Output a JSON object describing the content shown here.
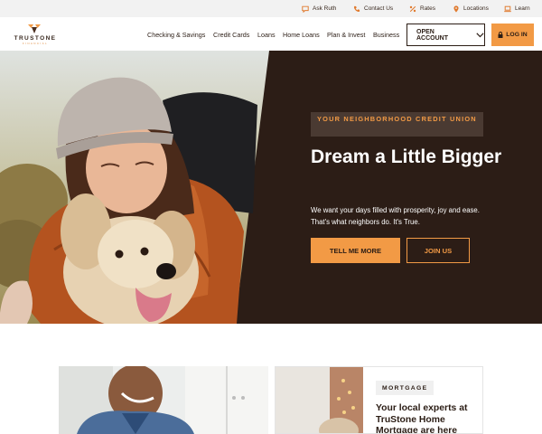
{
  "utility": {
    "items": [
      {
        "label": "Ask Ruth",
        "icon": "chat-icon"
      },
      {
        "label": "Contact Us",
        "icon": "phone-icon"
      },
      {
        "label": "Rates",
        "icon": "percent-icon"
      },
      {
        "label": "Locations",
        "icon": "location-pin-icon"
      },
      {
        "label": "Learn",
        "icon": "laptop-icon"
      }
    ]
  },
  "brand": {
    "name": "TRUSTONE",
    "tagline": "FINANCIAL",
    "accent": "#f29a45",
    "dark": "#2c1d16"
  },
  "nav": {
    "links": [
      "Checking & Savings",
      "Credit Cards",
      "Loans",
      "Home Loans",
      "Plan & Invest",
      "Business"
    ],
    "open_account": "OPEN ACCOUNT",
    "login": "LOG IN"
  },
  "hero": {
    "eyebrow": "YOUR NEIGHBORHOOD CREDIT UNION",
    "title": "Dream a Little Bigger",
    "text": "We want your days filled with prosperity, joy and ease. That's what neighbors do. It's True.",
    "primary_cta": "TELL ME MORE",
    "secondary_cta": "JOIN US"
  },
  "cards": {
    "mortgage": {
      "tag": "MORTGAGE",
      "title": "Your local experts at TruStone Home Mortgage are here"
    }
  }
}
